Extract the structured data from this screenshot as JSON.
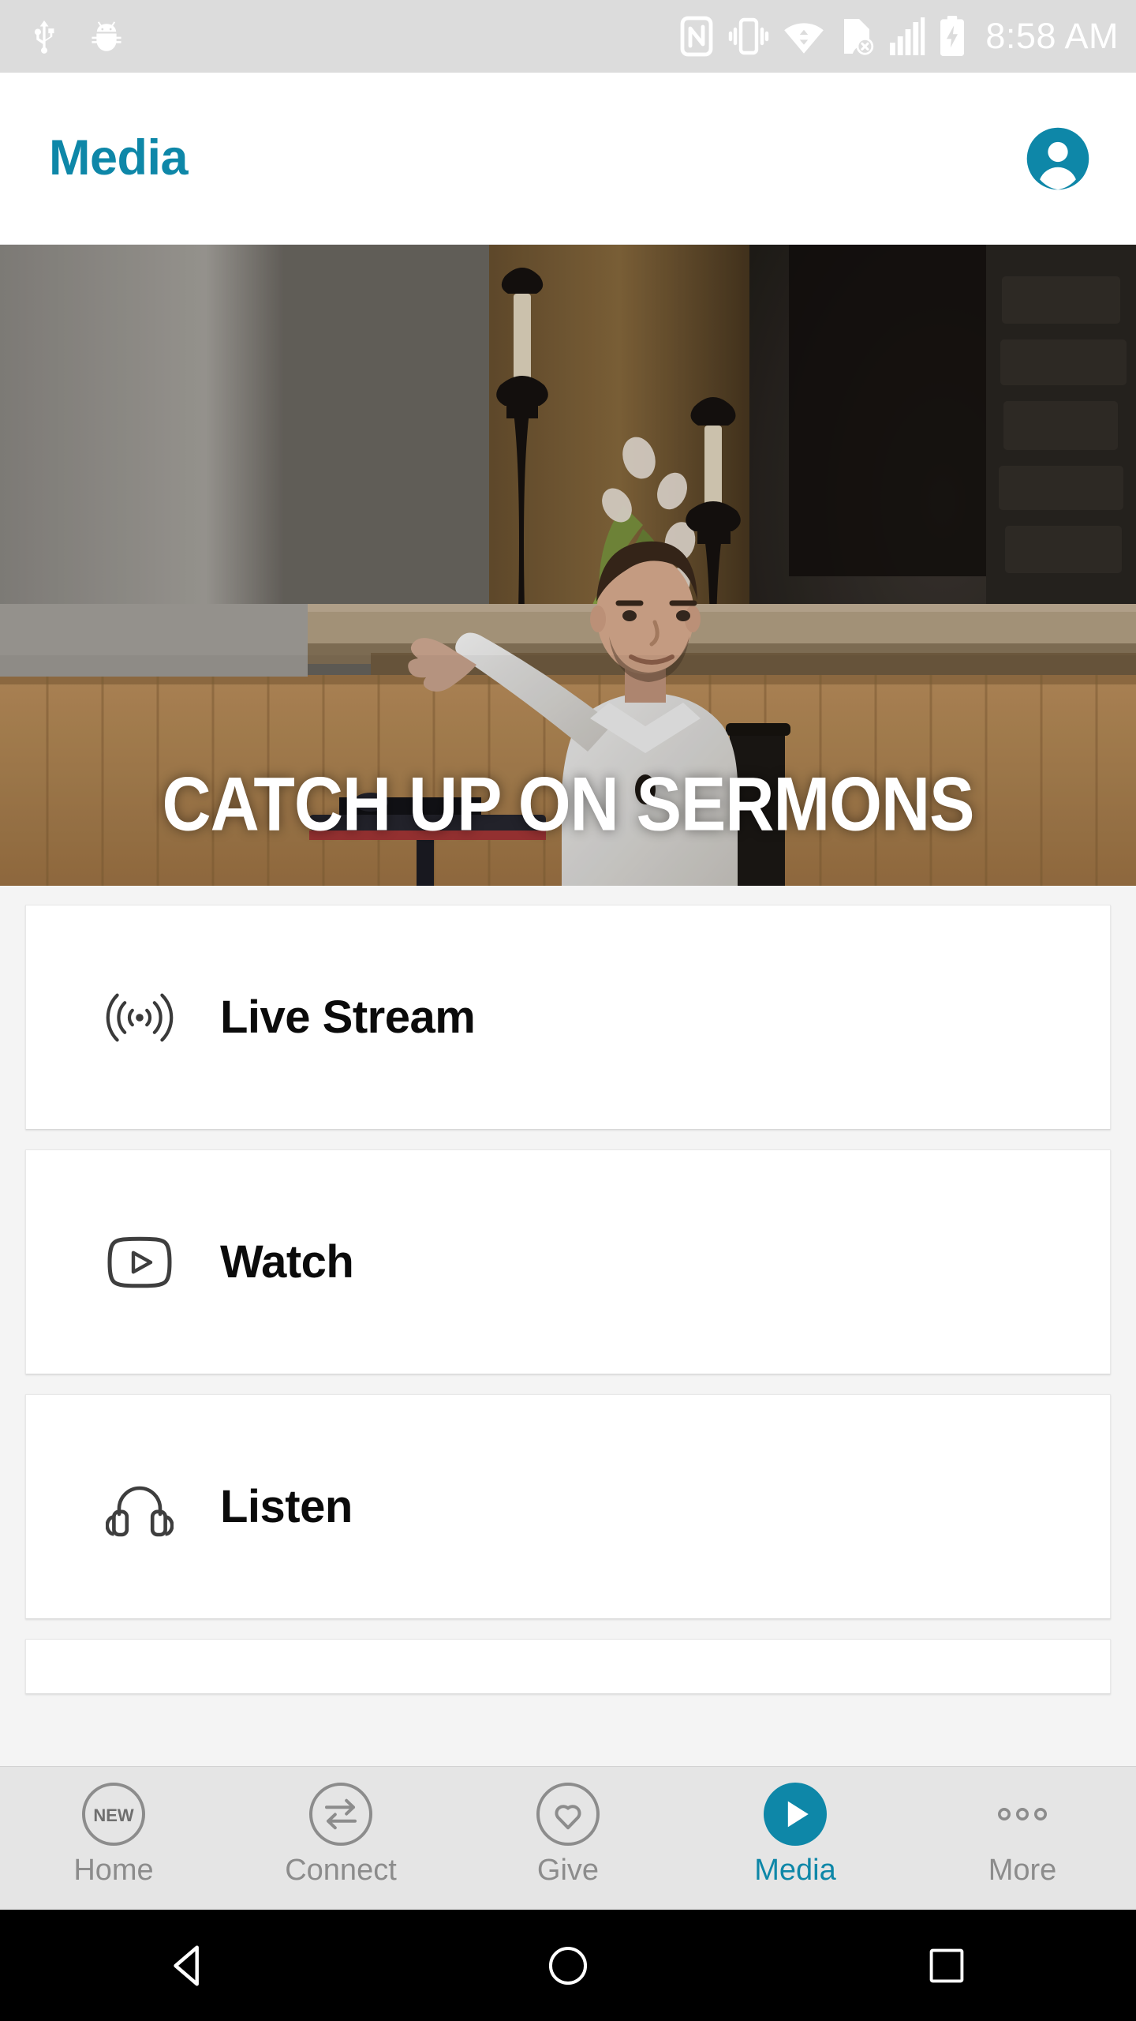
{
  "statusbar": {
    "time": "8:58 AM",
    "left_icons": [
      "usb-icon",
      "android-debug-bug-icon"
    ],
    "right_icons": [
      "nfc-icon",
      "vibrate-mode-icon",
      "wifi-icon",
      "sim-card-error-icon",
      "cellular-signal-icon",
      "battery-charging-icon"
    ],
    "background_color": "#dcdcdc",
    "icon_color": "#ffffff"
  },
  "header": {
    "title": "Media",
    "accent_color": "#0e87a8",
    "avatar_icon": "account-avatar-icon"
  },
  "hero": {
    "headline": "CATCH UP ON SERMONS",
    "description": "Church sanctuary with tall black candlesticks, white floral arrangement, wood paneling and a speaker in a white shirt gesturing beside a podium"
  },
  "menu": {
    "items": [
      {
        "label": "Live Stream",
        "icon": "broadcast-waves-icon"
      },
      {
        "label": "Watch",
        "icon": "play-rectangle-icon"
      },
      {
        "label": "Listen",
        "icon": "headphones-icon"
      }
    ]
  },
  "tabbar": {
    "items": [
      {
        "label": "Home",
        "icon": "new-circle-icon",
        "active": false
      },
      {
        "label": "Connect",
        "icon": "swap-arrows-icon",
        "active": false
      },
      {
        "label": "Give",
        "icon": "heart-outline-icon",
        "active": false
      },
      {
        "label": "Media",
        "icon": "play-filled-icon",
        "active": true
      },
      {
        "label": "More",
        "icon": "three-dots-icon",
        "active": false
      }
    ],
    "active_color": "#0e87a8",
    "inactive_color": "#8c8c8c",
    "home_badge_text": "NEW"
  },
  "navbar": {
    "back": "back-triangle-icon",
    "home": "home-circle-icon",
    "recents": "recents-square-icon"
  },
  "colors": {
    "accent": "#0e87a8",
    "page_background": "#f4f4f4",
    "card_background": "#ffffff",
    "status_background": "#dcdcdc",
    "tabbar_background": "#e5e5e5",
    "navbar_background": "#000000"
  }
}
